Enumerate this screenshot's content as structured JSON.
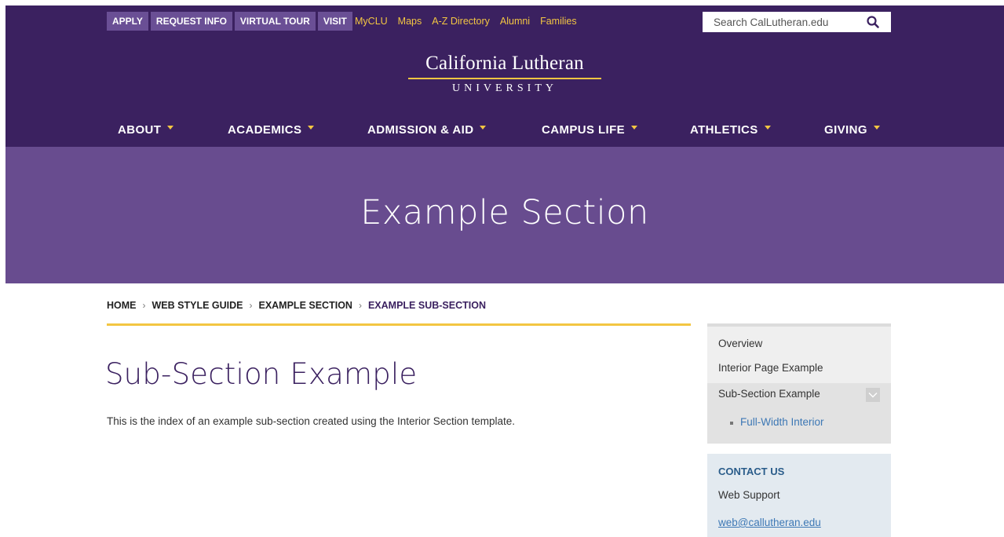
{
  "utility_bar": {
    "buttons": [
      "APPLY",
      "REQUEST INFO",
      "VIRTUAL TOUR",
      "VISIT"
    ],
    "links": [
      "MyCLU",
      "Maps",
      "A-Z Directory",
      "Alumni",
      "Families"
    ],
    "search_placeholder": "Search CalLutheran.edu"
  },
  "logo": {
    "line1": "California Lutheran",
    "line2": "UNIVERSITY"
  },
  "main_nav": [
    "ABOUT",
    "ACADEMICS",
    "ADMISSION & AID",
    "CAMPUS LIFE",
    "ATHLETICS",
    "GIVING"
  ],
  "banner": {
    "title": "Example Section"
  },
  "breadcrumb": [
    "HOME",
    "WEB STYLE GUIDE",
    "EXAMPLE SECTION",
    "EXAMPLE SUB-SECTION"
  ],
  "content": {
    "title": "Sub-Section Example",
    "intro": "This is the index of an example sub-section created using the Interior Section template."
  },
  "subnav": {
    "items": [
      "Overview",
      "Interior Page Example",
      "Sub-Section Example"
    ],
    "sub_items": [
      "Full-Width Interior"
    ]
  },
  "contact": {
    "heading": "CONTACT US",
    "name": "Web Support",
    "email": "web@callutheran.edu"
  },
  "colors": {
    "header_purple": "#3b2160",
    "banner_purple": "#684c8f",
    "gold_accent": "#f3c642",
    "link_blue": "#3d78b5"
  }
}
